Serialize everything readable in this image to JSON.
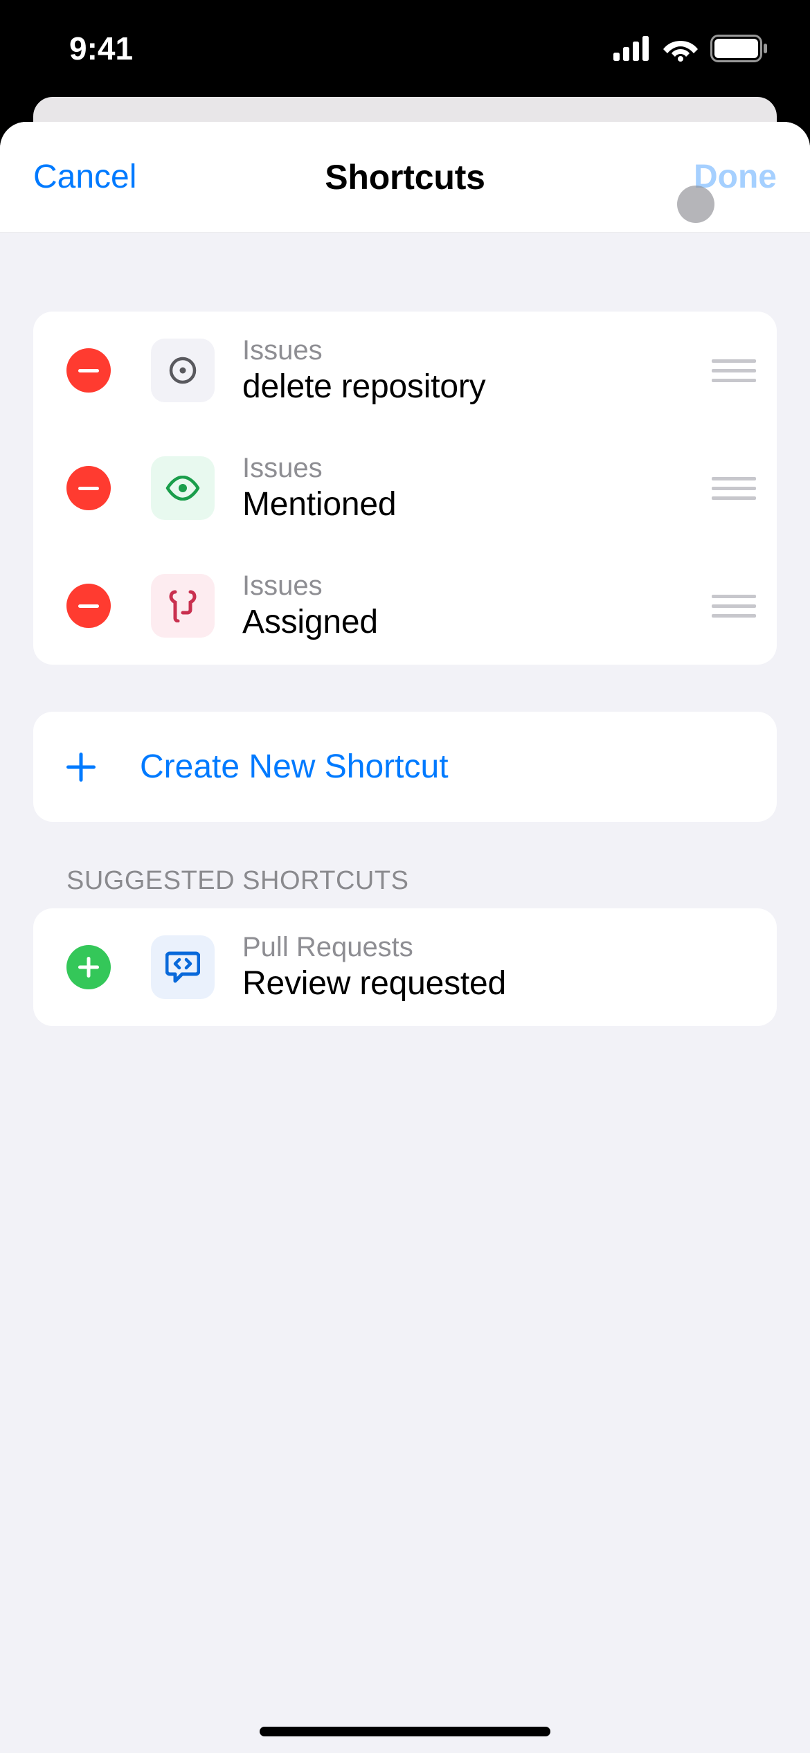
{
  "status": {
    "time": "9:41"
  },
  "nav": {
    "cancel": "Cancel",
    "title": "Shortcuts",
    "done": "Done"
  },
  "shortcuts": [
    {
      "category": "Issues",
      "title": "delete repository",
      "icon": "circle-dot-icon",
      "tint": "gray"
    },
    {
      "category": "Issues",
      "title": "Mentioned",
      "icon": "eye-icon",
      "tint": "green"
    },
    {
      "category": "Issues",
      "title": "Assigned",
      "icon": "tools-icon",
      "tint": "red"
    }
  ],
  "create": {
    "label": "Create New Shortcut"
  },
  "suggested_header": "SUGGESTED SHORTCUTS",
  "suggested": [
    {
      "category": "Pull Requests",
      "title": "Review requested",
      "icon": "code-review-icon",
      "tint": "blue"
    }
  ]
}
